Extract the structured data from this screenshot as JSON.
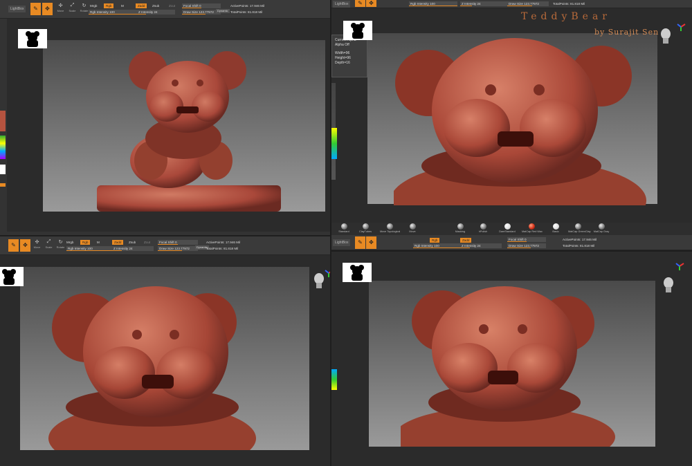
{
  "toolbar": {
    "lightbox": "LightBox",
    "draw_label": "Draw",
    "move_label": "Move",
    "scale_label": "Scale",
    "rotate_label": "Rotate",
    "mrgb": "Mrgb",
    "rgb": "Rgb",
    "m": "M",
    "zadd": "Zadd",
    "zsub": "Zsub",
    "zcut": "Zcut",
    "rgb_intensity": "Rgb Intensity 100",
    "z_intensity": "Z Intensity 24",
    "focal_shift": "Focal Shift 0",
    "draw_size": "Draw Size 123.77972",
    "dynamic": "Dynamic",
    "active_points": "ActivePoints: 17.946 Mil",
    "total_points": "TotalPoints: 81.818 Mil"
  },
  "tooltip": {
    "title": "Current Alpha",
    "state": "Alpha Off",
    "width": "Width=96",
    "height": "Height=96",
    "depth": "Depth=16"
  },
  "signature": {
    "title": "TeddyBear",
    "byline": "by Surajit Sen"
  },
  "brushes": [
    {
      "label": "Standard",
      "kind": "gray"
    },
    {
      "label": "ClayTubes",
      "kind": "gray"
    },
    {
      "label": "Move Topological",
      "kind": "gray"
    },
    {
      "label": "Move",
      "kind": "gray"
    },
    {
      "label": "Masking",
      "kind": "gray"
    },
    {
      "label": "hPolish",
      "kind": "gray"
    },
    {
      "label": "DamStandard",
      "kind": "white"
    },
    {
      "label": "MatCap Red Wax",
      "kind": "red"
    },
    {
      "label": "Basic",
      "kind": "gray"
    },
    {
      "label": "MatCap GreenClay",
      "kind": "gray"
    },
    {
      "label": "MatCap Gray",
      "kind": "gray"
    }
  ],
  "colors": {
    "accent": "#e88a23",
    "clay": "#b5533f",
    "viewport_top": "#4a4a4a",
    "viewport_bottom": "#9a9a9a"
  }
}
